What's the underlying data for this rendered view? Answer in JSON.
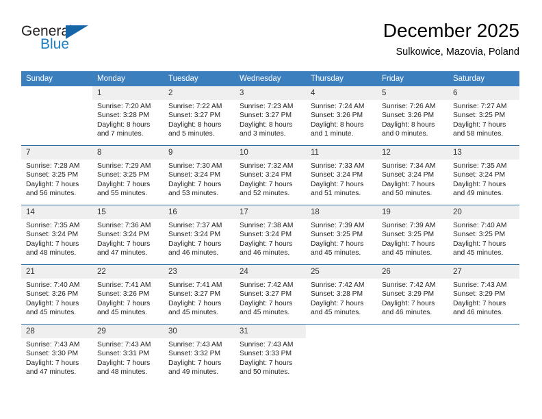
{
  "brand": {
    "name_part1": "General",
    "name_part2": "Blue",
    "accent_color": "#1c7fc4",
    "triangle_color": "#1665a8"
  },
  "header": {
    "title": "December 2025",
    "subtitle": "Sulkowice, Mazovia, Poland"
  },
  "calendar": {
    "header_bg": "#3c7fbf",
    "header_text_color": "#ffffff",
    "row_divider_color": "#2e6da4",
    "daynum_bg": "#efefef",
    "weekdays": [
      "Sunday",
      "Monday",
      "Tuesday",
      "Wednesday",
      "Thursday",
      "Friday",
      "Saturday"
    ],
    "weeks": [
      [
        {
          "day": "",
          "sunrise": "",
          "sunset": "",
          "daylight_line1": "",
          "daylight_line2": ""
        },
        {
          "day": "1",
          "sunrise": "Sunrise: 7:20 AM",
          "sunset": "Sunset: 3:28 PM",
          "daylight_line1": "Daylight: 8 hours",
          "daylight_line2": "and 7 minutes."
        },
        {
          "day": "2",
          "sunrise": "Sunrise: 7:22 AM",
          "sunset": "Sunset: 3:27 PM",
          "daylight_line1": "Daylight: 8 hours",
          "daylight_line2": "and 5 minutes."
        },
        {
          "day": "3",
          "sunrise": "Sunrise: 7:23 AM",
          "sunset": "Sunset: 3:27 PM",
          "daylight_line1": "Daylight: 8 hours",
          "daylight_line2": "and 3 minutes."
        },
        {
          "day": "4",
          "sunrise": "Sunrise: 7:24 AM",
          "sunset": "Sunset: 3:26 PM",
          "daylight_line1": "Daylight: 8 hours",
          "daylight_line2": "and 1 minute."
        },
        {
          "day": "5",
          "sunrise": "Sunrise: 7:26 AM",
          "sunset": "Sunset: 3:26 PM",
          "daylight_line1": "Daylight: 8 hours",
          "daylight_line2": "and 0 minutes."
        },
        {
          "day": "6",
          "sunrise": "Sunrise: 7:27 AM",
          "sunset": "Sunset: 3:25 PM",
          "daylight_line1": "Daylight: 7 hours",
          "daylight_line2": "and 58 minutes."
        }
      ],
      [
        {
          "day": "7",
          "sunrise": "Sunrise: 7:28 AM",
          "sunset": "Sunset: 3:25 PM",
          "daylight_line1": "Daylight: 7 hours",
          "daylight_line2": "and 56 minutes."
        },
        {
          "day": "8",
          "sunrise": "Sunrise: 7:29 AM",
          "sunset": "Sunset: 3:25 PM",
          "daylight_line1": "Daylight: 7 hours",
          "daylight_line2": "and 55 minutes."
        },
        {
          "day": "9",
          "sunrise": "Sunrise: 7:30 AM",
          "sunset": "Sunset: 3:24 PM",
          "daylight_line1": "Daylight: 7 hours",
          "daylight_line2": "and 53 minutes."
        },
        {
          "day": "10",
          "sunrise": "Sunrise: 7:32 AM",
          "sunset": "Sunset: 3:24 PM",
          "daylight_line1": "Daylight: 7 hours",
          "daylight_line2": "and 52 minutes."
        },
        {
          "day": "11",
          "sunrise": "Sunrise: 7:33 AM",
          "sunset": "Sunset: 3:24 PM",
          "daylight_line1": "Daylight: 7 hours",
          "daylight_line2": "and 51 minutes."
        },
        {
          "day": "12",
          "sunrise": "Sunrise: 7:34 AM",
          "sunset": "Sunset: 3:24 PM",
          "daylight_line1": "Daylight: 7 hours",
          "daylight_line2": "and 50 minutes."
        },
        {
          "day": "13",
          "sunrise": "Sunrise: 7:35 AM",
          "sunset": "Sunset: 3:24 PM",
          "daylight_line1": "Daylight: 7 hours",
          "daylight_line2": "and 49 minutes."
        }
      ],
      [
        {
          "day": "14",
          "sunrise": "Sunrise: 7:35 AM",
          "sunset": "Sunset: 3:24 PM",
          "daylight_line1": "Daylight: 7 hours",
          "daylight_line2": "and 48 minutes."
        },
        {
          "day": "15",
          "sunrise": "Sunrise: 7:36 AM",
          "sunset": "Sunset: 3:24 PM",
          "daylight_line1": "Daylight: 7 hours",
          "daylight_line2": "and 47 minutes."
        },
        {
          "day": "16",
          "sunrise": "Sunrise: 7:37 AM",
          "sunset": "Sunset: 3:24 PM",
          "daylight_line1": "Daylight: 7 hours",
          "daylight_line2": "and 46 minutes."
        },
        {
          "day": "17",
          "sunrise": "Sunrise: 7:38 AM",
          "sunset": "Sunset: 3:24 PM",
          "daylight_line1": "Daylight: 7 hours",
          "daylight_line2": "and 46 minutes."
        },
        {
          "day": "18",
          "sunrise": "Sunrise: 7:39 AM",
          "sunset": "Sunset: 3:25 PM",
          "daylight_line1": "Daylight: 7 hours",
          "daylight_line2": "and 45 minutes."
        },
        {
          "day": "19",
          "sunrise": "Sunrise: 7:39 AM",
          "sunset": "Sunset: 3:25 PM",
          "daylight_line1": "Daylight: 7 hours",
          "daylight_line2": "and 45 minutes."
        },
        {
          "day": "20",
          "sunrise": "Sunrise: 7:40 AM",
          "sunset": "Sunset: 3:25 PM",
          "daylight_line1": "Daylight: 7 hours",
          "daylight_line2": "and 45 minutes."
        }
      ],
      [
        {
          "day": "21",
          "sunrise": "Sunrise: 7:40 AM",
          "sunset": "Sunset: 3:26 PM",
          "daylight_line1": "Daylight: 7 hours",
          "daylight_line2": "and 45 minutes."
        },
        {
          "day": "22",
          "sunrise": "Sunrise: 7:41 AM",
          "sunset": "Sunset: 3:26 PM",
          "daylight_line1": "Daylight: 7 hours",
          "daylight_line2": "and 45 minutes."
        },
        {
          "day": "23",
          "sunrise": "Sunrise: 7:41 AM",
          "sunset": "Sunset: 3:27 PM",
          "daylight_line1": "Daylight: 7 hours",
          "daylight_line2": "and 45 minutes."
        },
        {
          "day": "24",
          "sunrise": "Sunrise: 7:42 AM",
          "sunset": "Sunset: 3:27 PM",
          "daylight_line1": "Daylight: 7 hours",
          "daylight_line2": "and 45 minutes."
        },
        {
          "day": "25",
          "sunrise": "Sunrise: 7:42 AM",
          "sunset": "Sunset: 3:28 PM",
          "daylight_line1": "Daylight: 7 hours",
          "daylight_line2": "and 45 minutes."
        },
        {
          "day": "26",
          "sunrise": "Sunrise: 7:42 AM",
          "sunset": "Sunset: 3:29 PM",
          "daylight_line1": "Daylight: 7 hours",
          "daylight_line2": "and 46 minutes."
        },
        {
          "day": "27",
          "sunrise": "Sunrise: 7:43 AM",
          "sunset": "Sunset: 3:29 PM",
          "daylight_line1": "Daylight: 7 hours",
          "daylight_line2": "and 46 minutes."
        }
      ],
      [
        {
          "day": "28",
          "sunrise": "Sunrise: 7:43 AM",
          "sunset": "Sunset: 3:30 PM",
          "daylight_line1": "Daylight: 7 hours",
          "daylight_line2": "and 47 minutes."
        },
        {
          "day": "29",
          "sunrise": "Sunrise: 7:43 AM",
          "sunset": "Sunset: 3:31 PM",
          "daylight_line1": "Daylight: 7 hours",
          "daylight_line2": "and 48 minutes."
        },
        {
          "day": "30",
          "sunrise": "Sunrise: 7:43 AM",
          "sunset": "Sunset: 3:32 PM",
          "daylight_line1": "Daylight: 7 hours",
          "daylight_line2": "and 49 minutes."
        },
        {
          "day": "31",
          "sunrise": "Sunrise: 7:43 AM",
          "sunset": "Sunset: 3:33 PM",
          "daylight_line1": "Daylight: 7 hours",
          "daylight_line2": "and 50 minutes."
        },
        {
          "day": "",
          "sunrise": "",
          "sunset": "",
          "daylight_line1": "",
          "daylight_line2": ""
        },
        {
          "day": "",
          "sunrise": "",
          "sunset": "",
          "daylight_line1": "",
          "daylight_line2": ""
        },
        {
          "day": "",
          "sunrise": "",
          "sunset": "",
          "daylight_line1": "",
          "daylight_line2": ""
        }
      ]
    ]
  }
}
